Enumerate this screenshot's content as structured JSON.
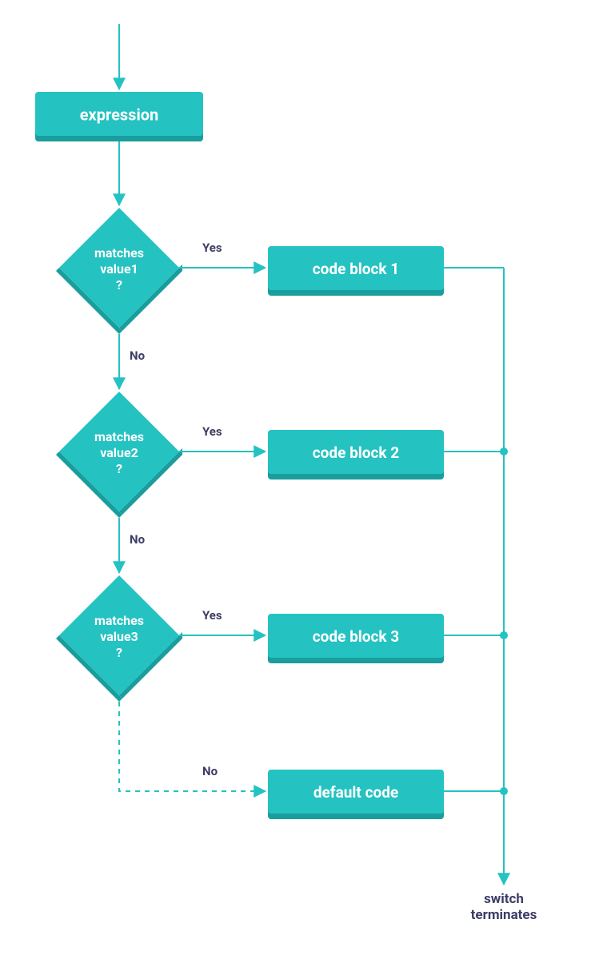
{
  "colors": {
    "node_fill": "#25c2c2",
    "node_shadow": "#1a9d9d",
    "line": "#25c2c2",
    "label": "#3c3c66"
  },
  "start": {
    "label": "expression"
  },
  "decisions": [
    {
      "line1": "matches",
      "line2": "value1",
      "line3": "?",
      "yes_label": "Yes",
      "no_label": "No"
    },
    {
      "line1": "matches",
      "line2": "value2",
      "line3": "?",
      "yes_label": "Yes",
      "no_label": "No"
    },
    {
      "line1": "matches",
      "line2": "value3",
      "line3": "?",
      "yes_label": "Yes",
      "no_label": "No"
    }
  ],
  "blocks": [
    {
      "label": "code block 1"
    },
    {
      "label": "code block 2"
    },
    {
      "label": "code block 3"
    },
    {
      "label": "default code"
    }
  ],
  "terminate": {
    "line1": "switch",
    "line2": "terminates"
  }
}
